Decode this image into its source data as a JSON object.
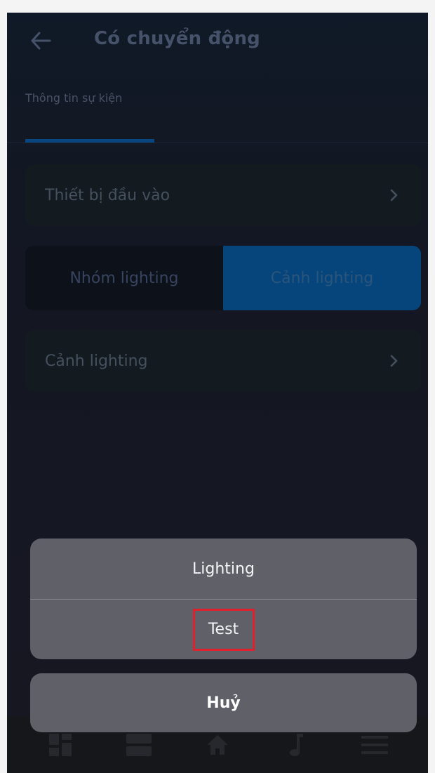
{
  "header": {
    "title": "Có chuyển động",
    "back_icon": "arrow-left-icon"
  },
  "tabs": [
    {
      "label": "Thông tin sự kiện",
      "active": true
    }
  ],
  "input_device": {
    "label": "Thiết bị đầu vào"
  },
  "segment": {
    "options": [
      "Nhóm lighting",
      "Cảnh lighting"
    ],
    "selected": "Cảnh lighting"
  },
  "scene_select": {
    "label": "Cảnh lighting"
  },
  "action_sheet": {
    "options": [
      "Lighting",
      "Test"
    ],
    "highlighted": "Test",
    "cancel_label": "Huỷ"
  },
  "bottom_nav": {
    "icons": [
      "dashboard-icon",
      "layout-icon",
      "home-icon",
      "music-icon",
      "menu-icon"
    ]
  },
  "colors": {
    "accent": "#0a4d8a",
    "sheet": "#606069",
    "highlight": "#e0202a"
  }
}
